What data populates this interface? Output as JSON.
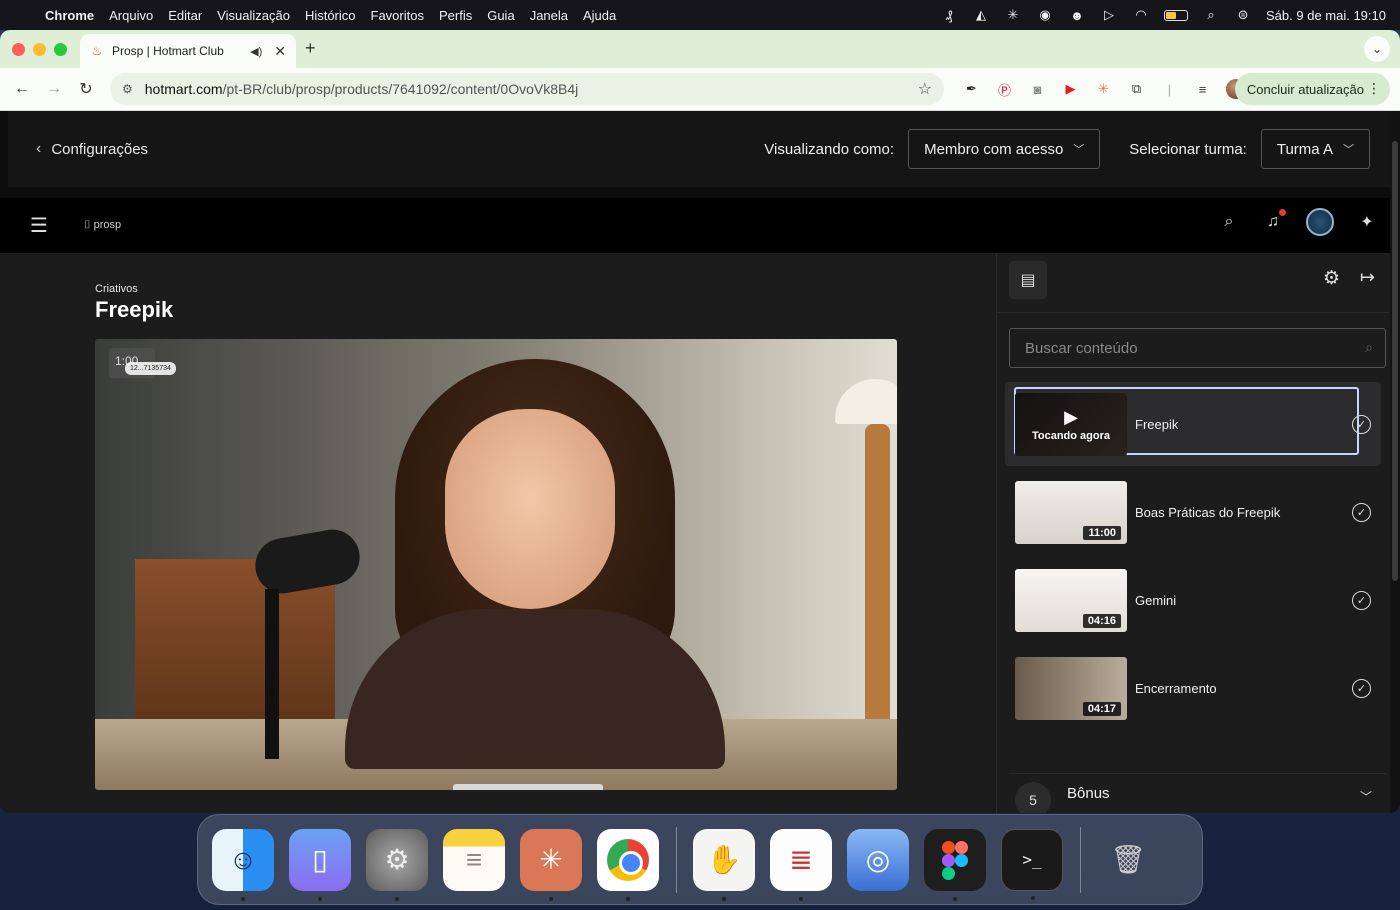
{
  "menubar": {
    "app_name": "Chrome",
    "menus": [
      "Arquivo",
      "Editar",
      "Visualização",
      "Histórico",
      "Favoritos",
      "Perfis",
      "Guia",
      "Janela",
      "Ajuda"
    ],
    "datetime": "Sáb. 9 de mai.  19:10"
  },
  "browser": {
    "tab_title": "Prosp | Hotmart Club",
    "url_host": "hotmart.com",
    "url_path": "/pt-BR/club/prosp/products/7641092/content/0OvoVk8B4j",
    "update_label": "Concluir atualização"
  },
  "admin_bar": {
    "back_label": "Configurações",
    "viewing_as_label": "Visualizando como:",
    "viewing_as_value": "Membro com acesso",
    "class_label": "Selecionar turma:",
    "class_value": "Turma A"
  },
  "header": {
    "logo_text": "prosp"
  },
  "lesson": {
    "module": "Criativos",
    "title": "Freepik",
    "video_timestamp": "1:00",
    "video_watermark": "12...7135734"
  },
  "sidebar": {
    "search_placeholder": "Buscar conteúdo",
    "lessons": [
      {
        "name": "Freepik",
        "status": "Tocando agora",
        "duration": ""
      },
      {
        "name": "Boas Práticas do Freepik",
        "duration": "11:00"
      },
      {
        "name": "Gemini",
        "duration": "04:16"
      },
      {
        "name": "Encerramento",
        "duration": "04:17"
      }
    ],
    "next_section": {
      "number": "5",
      "name": "Bônus"
    }
  },
  "dock": {
    "apps": [
      "Finder",
      "Simulator",
      "System Settings",
      "Notes",
      "Claude",
      "Google Chrome",
      "Hand Mirror",
      "TextEdit",
      "Preview",
      "Figma",
      "Terminal",
      "Trash"
    ]
  },
  "colors": {
    "tab_strip": "#dfeed6",
    "active_frame": "#c9d3ff",
    "page_bg": "#1c1c1c",
    "notification_dot": "#e53935"
  }
}
